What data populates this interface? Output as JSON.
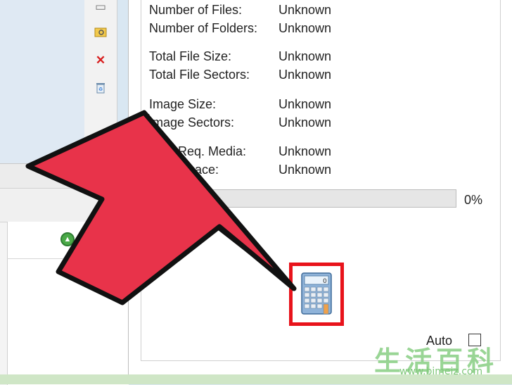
{
  "info": {
    "rows": [
      {
        "label": "Number of Files:",
        "value": "Unknown"
      },
      {
        "label": "Number of Folders:",
        "value": "Unknown"
      },
      {
        "label": "Total File Size:",
        "value": "Unknown"
      },
      {
        "label": "Total File Sectors:",
        "value": "Unknown"
      },
      {
        "label": "Image Size:",
        "value": "Unknown"
      },
      {
        "label": "Image Sectors:",
        "value": "Unknown"
      },
      {
        "label": "Req. Media:",
        "value": "Unknown"
      },
      {
        "label": "ace:",
        "value": "Unknown"
      }
    ]
  },
  "progress": {
    "percent_label": "0%",
    "fraction": 0.0
  },
  "auto": {
    "label": "Auto",
    "checked": false
  },
  "toolbar": {
    "icons": [
      "page-icon",
      "folder-search-icon",
      "delete-x-icon",
      "recycle-bin-icon",
      "green-arrow-icon"
    ]
  },
  "calculator": {
    "icon": "calculator-icon",
    "highlight_color": "#e8131b"
  },
  "arrow": {
    "color": "#e8334a",
    "outline": "#111111"
  },
  "watermark": {
    "chars": "生活百科",
    "url": "www.bimeiz.com"
  }
}
